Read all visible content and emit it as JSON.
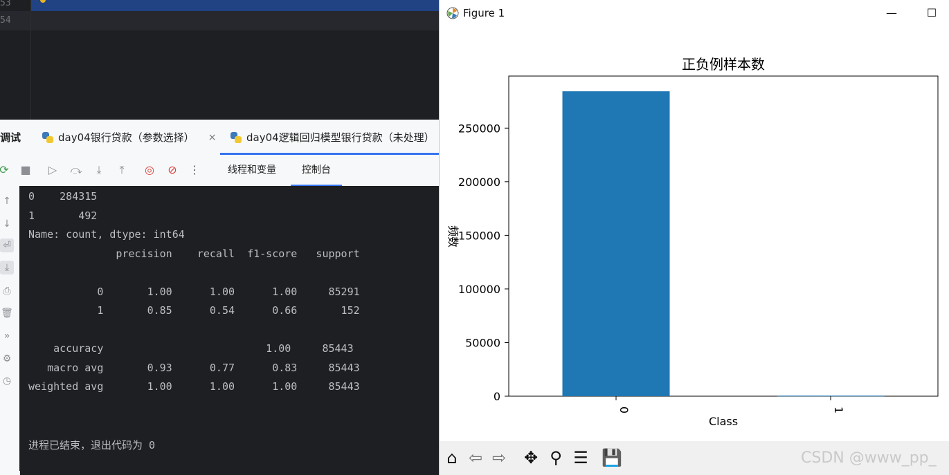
{
  "editor": {
    "line_numbers": [
      "53",
      "54"
    ]
  },
  "tabs": {
    "debug_label": "调试",
    "items": [
      {
        "label": "day04银行贷款（参数选择）",
        "close": "×"
      },
      {
        "label": "day04逻辑回归模型银行贷款（未处理）",
        "close": "("
      }
    ]
  },
  "toolbar": {
    "icons": [
      "rerun-icon",
      "stop-icon",
      "resume-icon",
      "step-over-icon",
      "step-into-icon",
      "step-out-icon",
      "view-breakpoints-icon",
      "mute-breakpoints-icon",
      "more-icon"
    ],
    "subtabs": [
      {
        "label": "线程和变量",
        "active": false
      },
      {
        "label": "控制台",
        "active": true
      }
    ]
  },
  "console": {
    "lines": [
      "0    284315",
      "1       492",
      "Name: count, dtype: int64",
      "              precision    recall  f1-score   support",
      "",
      "           0       1.00      1.00      1.00     85291",
      "           1       0.85      0.54      0.66       152",
      "",
      "    accuracy                          1.00     85443",
      "   macro avg       0.93      0.77      0.83     85443",
      "weighted avg       1.00      1.00      1.00     85443",
      "",
      "",
      "进程已结束，退出代码为 0"
    ]
  },
  "figure": {
    "window_title": "Figure 1",
    "minimize_glyph": "—",
    "maximize_glyph": "☐",
    "watermark": "CSDN @www_pp_",
    "toolbar_icons": [
      "home-icon",
      "back-icon",
      "forward-icon",
      "pan-icon",
      "zoom-icon",
      "configure-subplots-icon",
      "save-icon"
    ]
  },
  "chart_data": {
    "type": "bar",
    "title": "正负例样本数",
    "xlabel": "Class",
    "ylabel": "频数",
    "categories": [
      "0",
      "1"
    ],
    "values": [
      284315,
      492
    ],
    "ylim": [
      0,
      298540
    ],
    "yticks": [
      0,
      50000,
      100000,
      150000,
      200000,
      250000
    ],
    "bar_color": "#1f77b4",
    "grid": false,
    "xtick_rotation": 90
  }
}
